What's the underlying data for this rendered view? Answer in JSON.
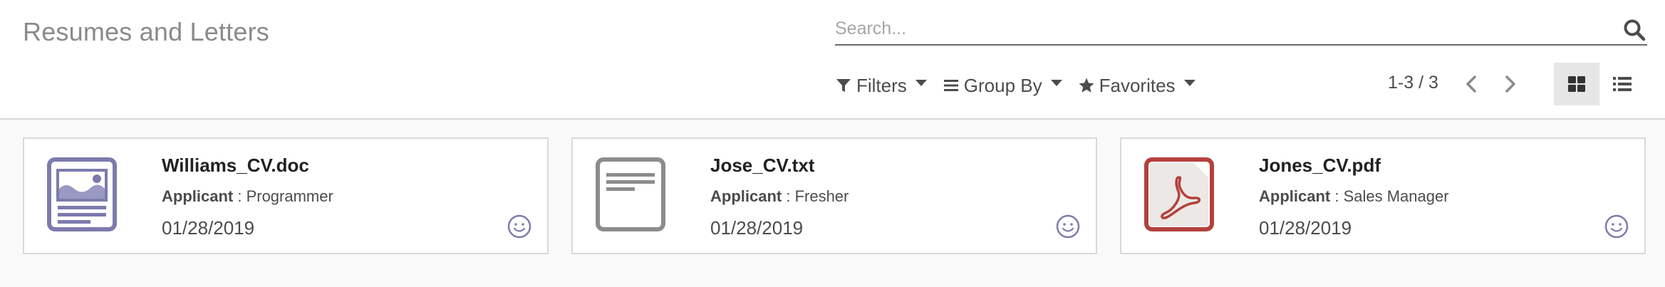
{
  "breadcrumb": {
    "title": "Resumes and Letters"
  },
  "search": {
    "placeholder": "Search...",
    "value": ""
  },
  "filters": {
    "filters_label": "Filters",
    "group_by_label": "Group By",
    "favorites_label": "Favorites"
  },
  "pager": {
    "text": "1-3 / 3"
  },
  "views": {
    "active": "kanban"
  },
  "colors": {
    "accent": "#7c7bad",
    "pdf_red": "#b3413b",
    "text_grey": "#8a8a8a"
  },
  "cards": [
    {
      "name": "Williams_CV.doc",
      "applicant_label": "Applicant",
      "applicant_value": " : Programmer",
      "date": "01/28/2019",
      "icon": "document-image-icon"
    },
    {
      "name": "Jose_CV.txt",
      "applicant_label": "Applicant",
      "applicant_value": " : Fresher",
      "date": "01/28/2019",
      "icon": "text-file-icon"
    },
    {
      "name": "Jones_CV.pdf",
      "applicant_label": "Applicant",
      "applicant_value": " : Sales Manager",
      "date": "01/28/2019",
      "icon": "pdf-file-icon"
    }
  ]
}
